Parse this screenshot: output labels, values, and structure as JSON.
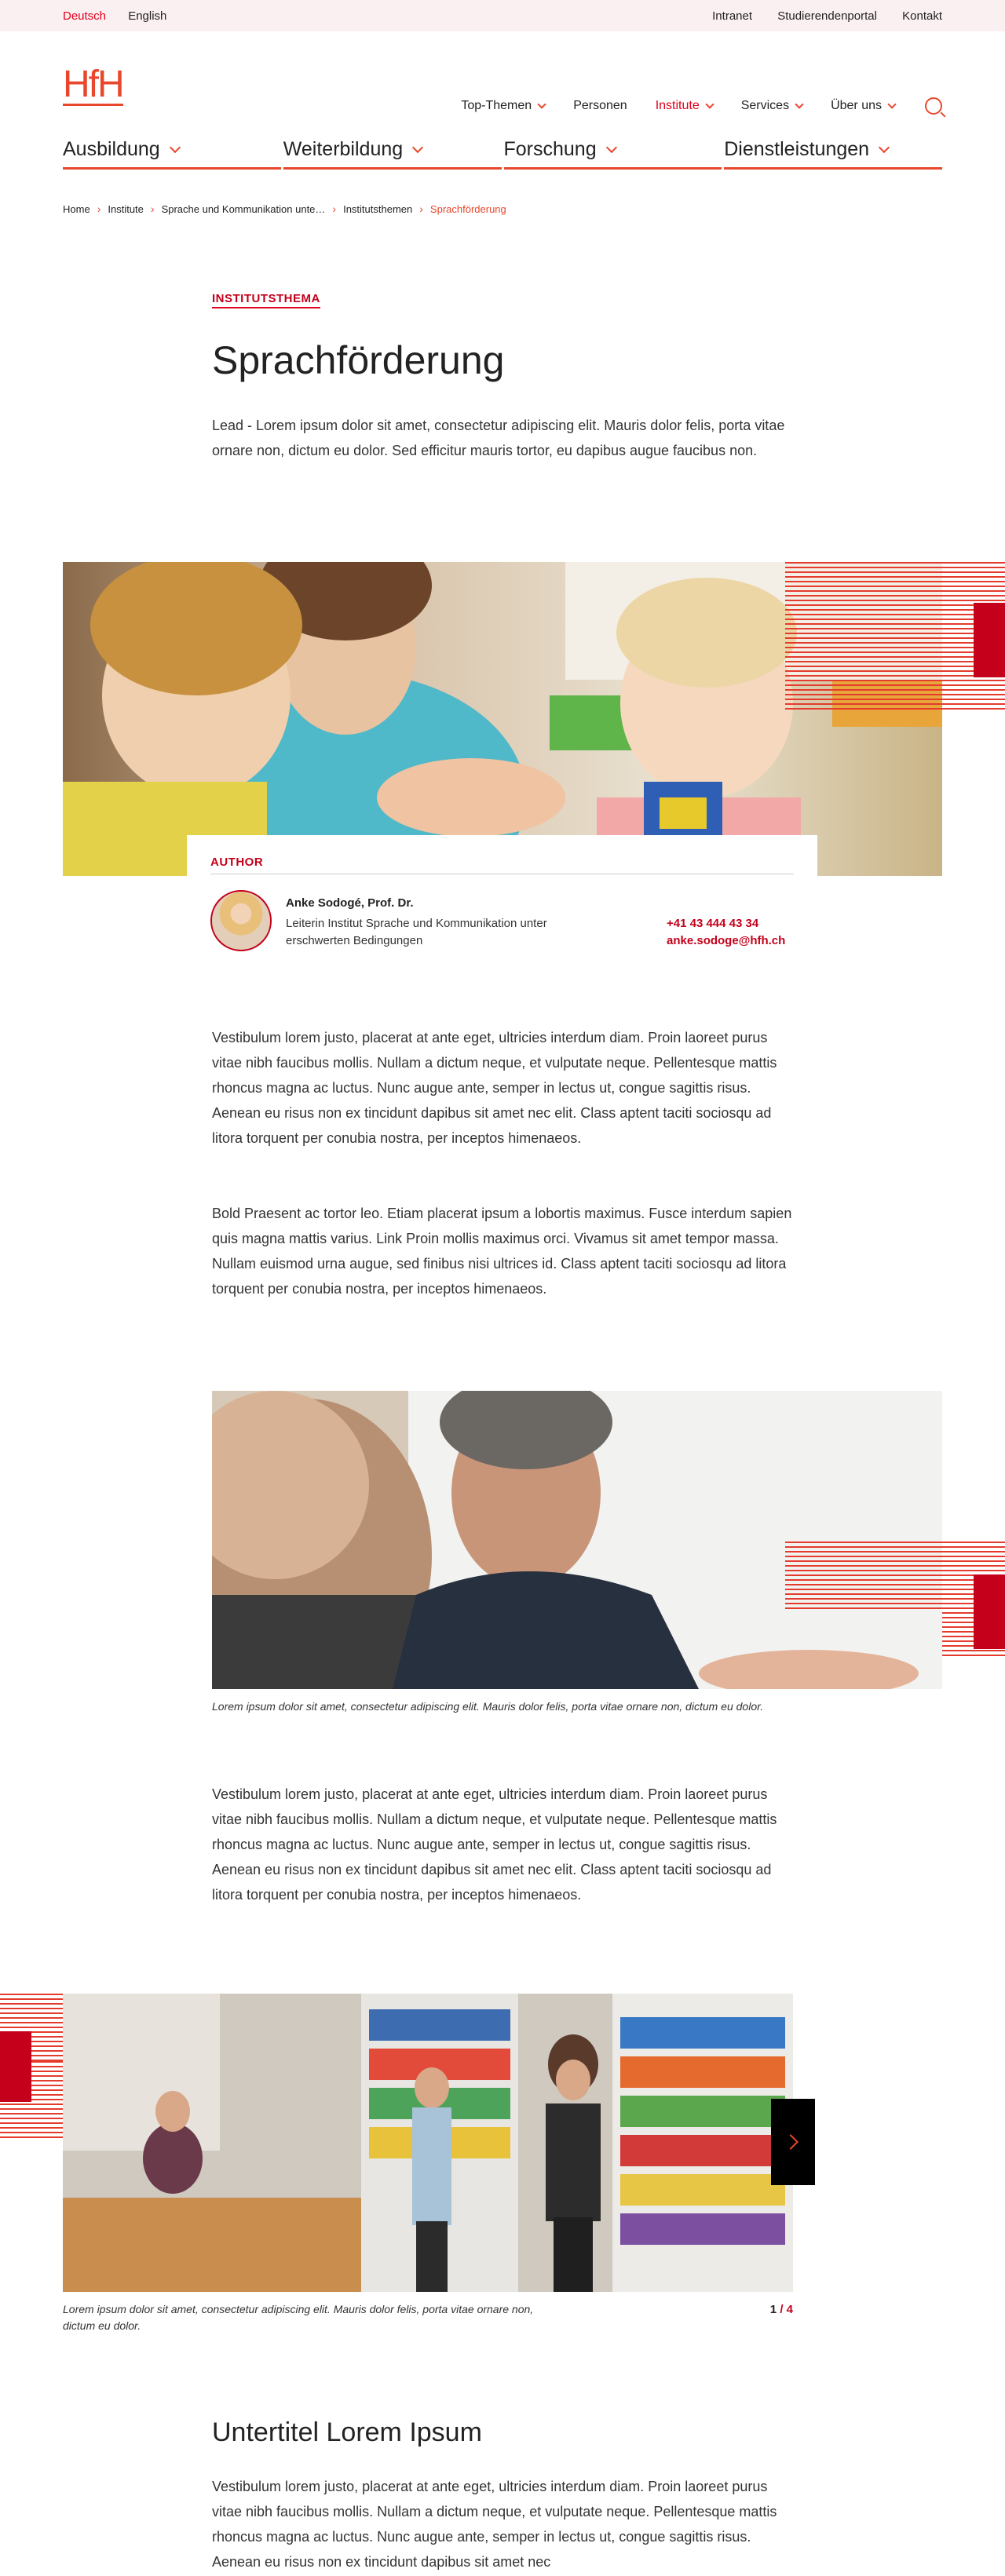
{
  "topbar": {
    "languages": [
      "Deutsch",
      "English"
    ],
    "links": [
      "Intranet",
      "Studierendenportal",
      "Kontakt"
    ]
  },
  "logo": "HfH",
  "nav": {
    "items": [
      "Top-Themen",
      "Personen",
      "Institute",
      "Services",
      "Über uns"
    ],
    "active": "Institute"
  },
  "categories": [
    "Ausbildung",
    "Weiterbildung",
    "Forschung",
    "Dienstleistungen"
  ],
  "breadcrumb": [
    "Home",
    "Institute",
    "Sprache und Kommunikation unte…",
    "Institutsthemen",
    "Sprachförderung"
  ],
  "page": {
    "eyebrow": "INSTITUTSTHEMA",
    "title": "Sprachförderung",
    "lead": "Lead - Lorem ipsum dolor sit amet, consectetur adipiscing elit. Mauris dolor felis, porta vitae ornare non, dictum eu dolor. Sed efficitur mauris tortor, eu dapibus augue faucibus non."
  },
  "author": {
    "label": "AUTHOR",
    "name": "Anke Sodogé, Prof. Dr.",
    "role": "Leiterin Institut Sprache und Kommunikation unter erschwerten Bedingungen",
    "phone": "+41 43 444 43 34",
    "email": "anke.sodoge@hfh.ch"
  },
  "paragraphs": {
    "p1": "Vestibulum lorem justo, placerat at ante eget, ultricies interdum diam. Proin laoreet purus vitae nibh faucibus mollis. Nullam a dictum neque, et vulputate neque. Pellentesque mattis rhoncus magna ac luctus. Nunc augue ante, semper in lectus ut, congue sagittis risus. Aenean eu risus non ex tincidunt dapibus sit amet nec elit. Class aptent taciti sociosqu ad litora torquent per conubia nostra, per inceptos himenaeos.",
    "p2": "Bold Praesent ac tortor leo. Etiam placerat ipsum a lobortis maximus. Fusce interdum sapien quis magna mattis varius. Link Proin mollis maximus orci. Vivamus sit amet tempor massa. Nullam euismod urna augue, sed finibus nisi ultrices id. Class aptent taciti sociosqu ad litora torquent per conubia nostra, per inceptos himenaeos.",
    "p3": "Vestibulum lorem justo, placerat at ante eget, ultricies interdum diam. Proin laoreet purus vitae nibh faucibus mollis. Nullam a dictum neque, et vulputate neque. Pellentesque mattis rhoncus magna ac luctus. Nunc augue ante, semper in lectus ut, congue sagittis risus. Aenean eu risus non ex tincidunt dapibus sit amet nec elit. Class aptent taciti sociosqu ad litora torquent per conubia nostra, per inceptos himenaeos.",
    "p4": "Vestibulum lorem justo, placerat at ante eget, ultricies interdum diam. Proin laoreet purus vitae nibh faucibus mollis. Nullam a dictum neque, et vulputate neque. Pellentesque mattis rhoncus magna ac luctus. Nunc augue ante, semper in lectus ut, congue sagittis risus. Aenean eu risus non ex tincidunt dapibus sit amet nec"
  },
  "image_caption": "Lorem ipsum dolor sit amet, consectetur adipiscing elit. Mauris dolor felis, porta vitae ornare non, dictum eu dolor.",
  "gallery": {
    "caption": "Lorem ipsum dolor sit amet, consectetur adipiscing elit. Mauris dolor felis, porta vitae ornare non, dictum eu dolor.",
    "current": "1",
    "separator": "/",
    "total": "4",
    "next_icon": "chevron-right-icon"
  },
  "subtitle": "Untertitel Lorem Ipsum",
  "colors": {
    "accent": "#e9472d",
    "brand_red": "#c4001a",
    "topbar_bg": "#fbf0f1"
  }
}
